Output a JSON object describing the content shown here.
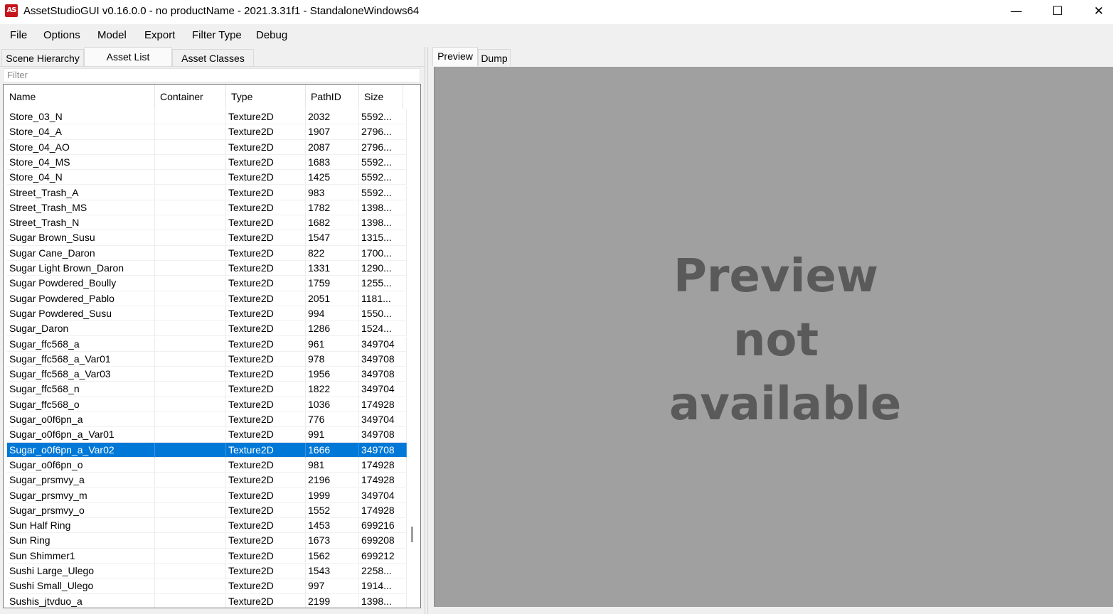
{
  "window": {
    "title": "AssetStudioGUI v0.16.0.0 - no productName - 2021.3.31f1 - StandaloneWindows64",
    "icon": "AS",
    "minimize": "—",
    "maximize": "☐",
    "close": "✕"
  },
  "menu": [
    "File",
    "Options",
    "Model",
    "Export",
    "Filter Type",
    "Debug"
  ],
  "left_tabs": [
    "Scene Hierarchy",
    "Asset List",
    "Asset Classes"
  ],
  "active_left_tab": "Asset List",
  "filter": {
    "placeholder": "Filter"
  },
  "columns": [
    "Name",
    "Container",
    "Type",
    "PathID",
    "Size"
  ],
  "rows": [
    [
      "Store_03_N",
      "",
      "Texture2D",
      "2032",
      "5592..."
    ],
    [
      "Store_04_A",
      "",
      "Texture2D",
      "1907",
      "2796..."
    ],
    [
      "Store_04_AO",
      "",
      "Texture2D",
      "2087",
      "2796..."
    ],
    [
      "Store_04_MS",
      "",
      "Texture2D",
      "1683",
      "5592..."
    ],
    [
      "Store_04_N",
      "",
      "Texture2D",
      "1425",
      "5592..."
    ],
    [
      "Street_Trash_A",
      "",
      "Texture2D",
      "983",
      "5592..."
    ],
    [
      "Street_Trash_MS",
      "",
      "Texture2D",
      "1782",
      "1398..."
    ],
    [
      "Street_Trash_N",
      "",
      "Texture2D",
      "1682",
      "1398..."
    ],
    [
      "Sugar Brown_Susu",
      "",
      "Texture2D",
      "1547",
      "1315..."
    ],
    [
      "Sugar Cane_Daron",
      "",
      "Texture2D",
      "822",
      "1700..."
    ],
    [
      "Sugar Light Brown_Daron",
      "",
      "Texture2D",
      "1331",
      "1290..."
    ],
    [
      "Sugar Powdered_Boully",
      "",
      "Texture2D",
      "1759",
      "1255..."
    ],
    [
      "Sugar Powdered_Pablo",
      "",
      "Texture2D",
      "2051",
      "1181..."
    ],
    [
      "Sugar Powdered_Susu",
      "",
      "Texture2D",
      "994",
      "1550..."
    ],
    [
      "Sugar_Daron",
      "",
      "Texture2D",
      "1286",
      "1524..."
    ],
    [
      "Sugar_ffc568_a",
      "",
      "Texture2D",
      "961",
      "349704"
    ],
    [
      "Sugar_ffc568_a_Var01",
      "",
      "Texture2D",
      "978",
      "349708"
    ],
    [
      "Sugar_ffc568_a_Var03",
      "",
      "Texture2D",
      "1956",
      "349708"
    ],
    [
      "Sugar_ffc568_n",
      "",
      "Texture2D",
      "1822",
      "349704"
    ],
    [
      "Sugar_ffc568_o",
      "",
      "Texture2D",
      "1036",
      "174928"
    ],
    [
      "Sugar_o0f6pn_a",
      "",
      "Texture2D",
      "776",
      "349704"
    ],
    [
      "Sugar_o0f6pn_a_Var01",
      "",
      "Texture2D",
      "991",
      "349708"
    ],
    [
      "Sugar_o0f6pn_a_Var02",
      "",
      "Texture2D",
      "1666",
      "349708"
    ],
    [
      "Sugar_o0f6pn_o",
      "",
      "Texture2D",
      "981",
      "174928"
    ],
    [
      "Sugar_prsmvy_a",
      "",
      "Texture2D",
      "2196",
      "174928"
    ],
    [
      "Sugar_prsmvy_m",
      "",
      "Texture2D",
      "1999",
      "349704"
    ],
    [
      "Sugar_prsmvy_o",
      "",
      "Texture2D",
      "1552",
      "174928"
    ],
    [
      "Sun Half Ring",
      "",
      "Texture2D",
      "1453",
      "699216"
    ],
    [
      "Sun Ring",
      "",
      "Texture2D",
      "1673",
      "699208"
    ],
    [
      "Sun Shimmer1",
      "",
      "Texture2D",
      "1562",
      "699212"
    ],
    [
      "Sushi Large_Ulego",
      "",
      "Texture2D",
      "1543",
      "2258..."
    ],
    [
      "Sushi Small_Ulego",
      "",
      "Texture2D",
      "997",
      "1914..."
    ],
    [
      "Sushis_jtvduo_a",
      "",
      "Texture2D",
      "2199",
      "1398..."
    ]
  ],
  "selected_row": 22,
  "right_tabs": [
    "Preview",
    "Dump"
  ],
  "active_right_tab": "Preview",
  "preview": {
    "line1": "Preview",
    "line2": "not",
    "line3": "available"
  },
  "colors": {
    "selection": "#0078d7",
    "preview_bg": "#a0a0a0",
    "preview_text": "#5a5a5a"
  }
}
